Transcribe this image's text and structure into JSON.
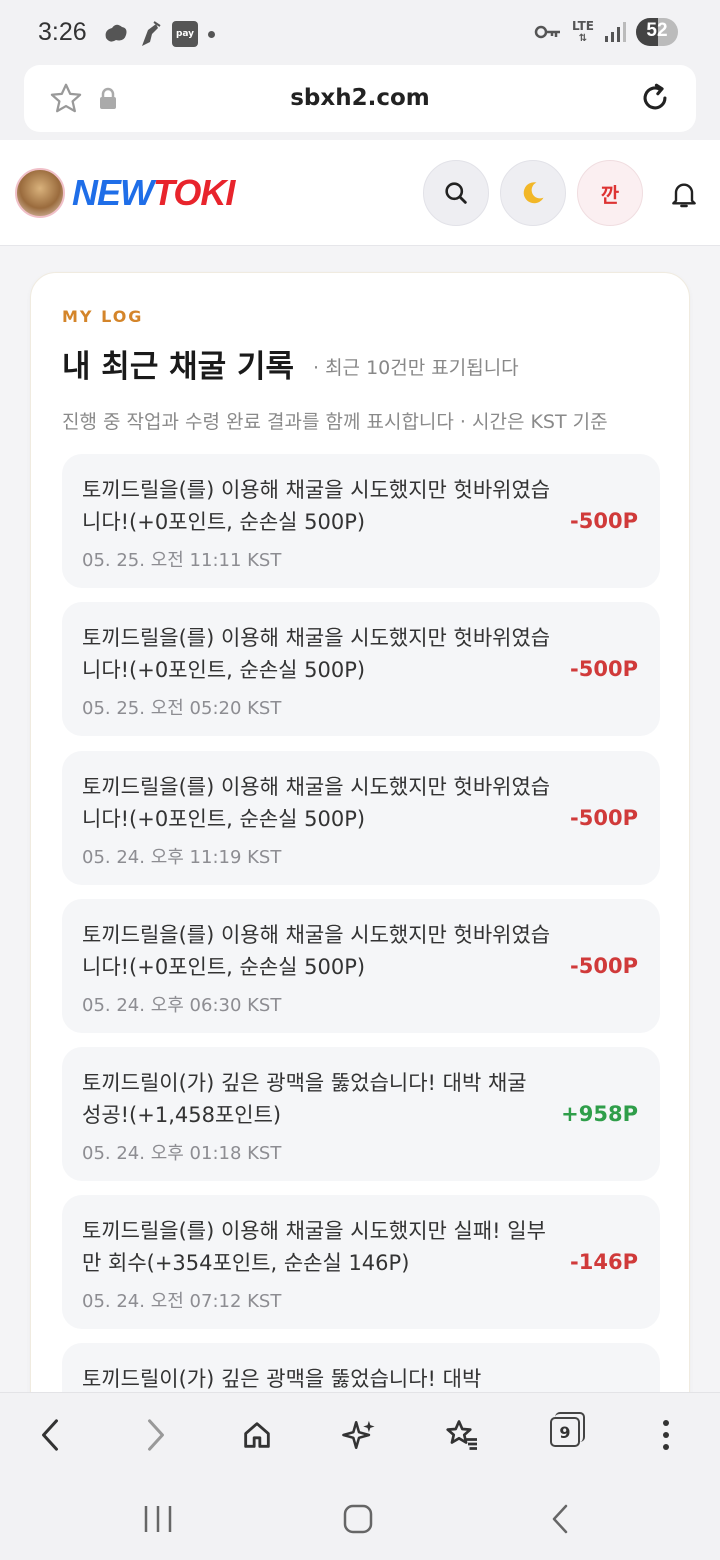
{
  "status_bar": {
    "time": "3:26",
    "pay_label": "pay",
    "network": "LTE",
    "battery": "52",
    "battery_level": 0.52
  },
  "address_bar": {
    "url": "sbxh2.com"
  },
  "header": {
    "logo_part1": "NEW",
    "logo_part2": "TOKI",
    "kkan_label": "깐"
  },
  "card": {
    "eyebrow": "MY LOG",
    "title": "내 최근 채굴 기록",
    "subtitle": "· 최근 10건만 표기됩니다",
    "description": "진행 중 작업과 수령 완료 결과를 함께 표시합니다 · 시간은 KST 기준",
    "logs": [
      {
        "message": "토끼드릴을(를) 이용해 채굴을 시도했지만 헛바위였습니다!(+0포인트, 순손실 500P)",
        "time": "05. 25. 오전 11:11 KST",
        "amount": "-500P",
        "type": "neg"
      },
      {
        "message": "토끼드릴을(를) 이용해 채굴을 시도했지만 헛바위였습니다!(+0포인트, 순손실 500P)",
        "time": "05. 25. 오전 05:20 KST",
        "amount": "-500P",
        "type": "neg"
      },
      {
        "message": "토끼드릴을(를) 이용해 채굴을 시도했지만 헛바위였습니다!(+0포인트, 순손실 500P)",
        "time": "05. 24. 오후 11:19 KST",
        "amount": "-500P",
        "type": "neg"
      },
      {
        "message": "토끼드릴을(를) 이용해 채굴을 시도했지만 헛바위였습니다!(+0포인트, 순손실 500P)",
        "time": "05. 24. 오후 06:30 KST",
        "amount": "-500P",
        "type": "neg"
      },
      {
        "message": "토끼드릴이(가) 깊은 광맥을 뚫었습니다! 대박 채굴 성공!(+1,458포인트)",
        "time": "05. 24. 오후 01:18 KST",
        "amount": "+958P",
        "type": "pos"
      },
      {
        "message": "토끼드릴을(를) 이용해 채굴을 시도했지만 실패! 일부만 회수(+354포인트, 순손실 146P)",
        "time": "05. 24. 오전 07:12 KST",
        "amount": "-146P",
        "type": "neg"
      },
      {
        "message": "토끼드릴이(가) 깊은 광맥을 뚫었습니다! 대박",
        "time": "",
        "amount": "",
        "type": "pos"
      }
    ]
  },
  "browser_toolbar": {
    "tab_count": "9"
  },
  "icons": {
    "bookmark": "star-outline-icon",
    "lock": "lock-icon",
    "reload": "reload-icon",
    "search": "search-icon",
    "theme": "moon-icon",
    "notifications": "bell-icon",
    "back": "chevron-left-icon",
    "forward": "chevron-right-icon",
    "home": "home-icon",
    "ai": "sparkle-icon",
    "bookmarks": "star-list-icon",
    "tabs": "tabs-icon",
    "more": "more-vertical-icon"
  },
  "colors": {
    "accent_eyebrow": "#d4852a",
    "negative": "#d03a3a",
    "positive": "#2f9e4a",
    "logo_blue": "#1f6ee8",
    "logo_red": "#e8242c"
  }
}
